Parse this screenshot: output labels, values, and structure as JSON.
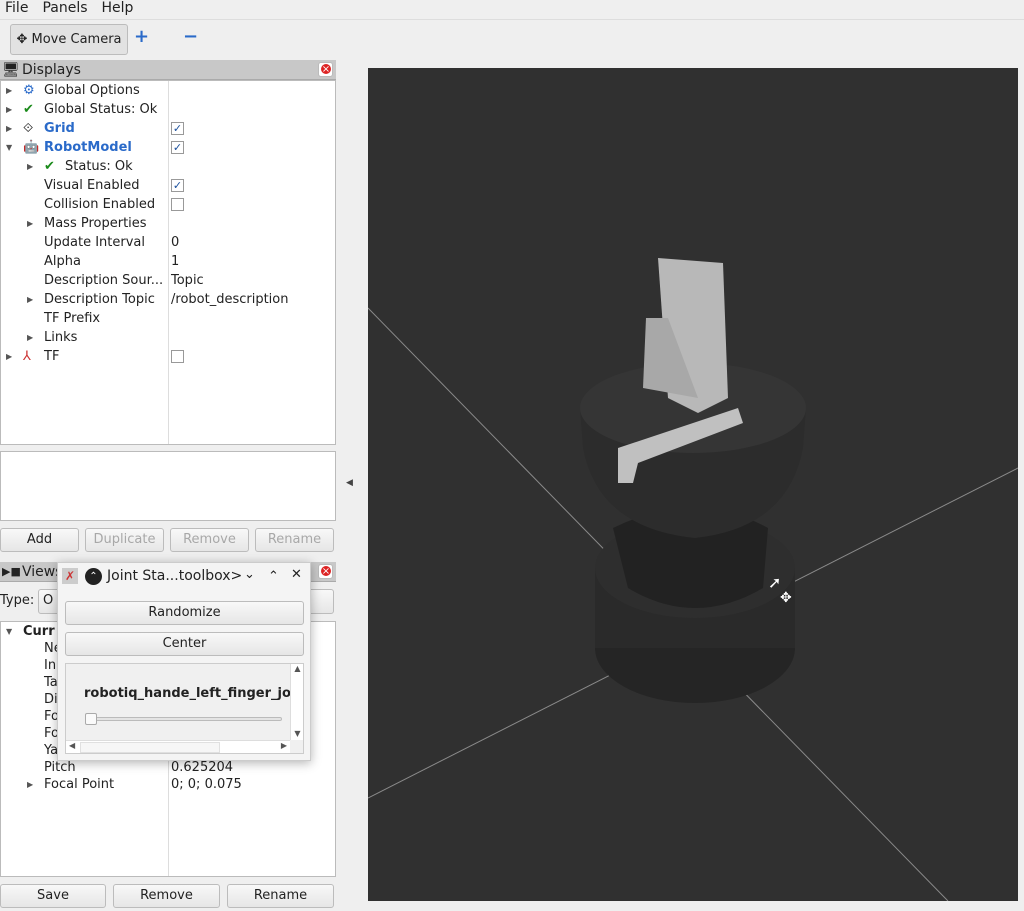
{
  "menu": [
    "File",
    "Panels",
    "Help"
  ],
  "toolbar": {
    "move_camera": "Move Camera",
    "add": "+",
    "remove": "−"
  },
  "displays": {
    "title": "Displays",
    "rows": [
      {
        "label": "Global Options",
        "value": ""
      },
      {
        "label": "Global Status: Ok",
        "value": ""
      },
      {
        "label": "Grid",
        "value": ""
      },
      {
        "label": "RobotModel",
        "value": ""
      },
      {
        "label": "Status: Ok",
        "value": ""
      },
      {
        "label": "Visual Enabled",
        "value": ""
      },
      {
        "label": "Collision Enabled",
        "value": ""
      },
      {
        "label": "Mass Properties",
        "value": ""
      },
      {
        "label": "Update Interval",
        "value": "0"
      },
      {
        "label": "Alpha",
        "value": "1"
      },
      {
        "label": "Description Sour...",
        "value": "Topic"
      },
      {
        "label": "Description Topic",
        "value": "/robot_description"
      },
      {
        "label": "TF Prefix",
        "value": ""
      },
      {
        "label": "Links",
        "value": ""
      },
      {
        "label": "TF",
        "value": ""
      }
    ],
    "buttons": {
      "add": "Add",
      "duplicate": "Duplicate",
      "remove": "Remove",
      "rename": "Rename"
    }
  },
  "views": {
    "title": "Views",
    "type_label": "Type:",
    "type_value": "O",
    "rows": [
      {
        "label": "Curr",
        "value": ""
      },
      {
        "label": "Ne",
        "value": ""
      },
      {
        "label": "In",
        "value": ""
      },
      {
        "label": "Ta",
        "value": ""
      },
      {
        "label": "Di",
        "value": ""
      },
      {
        "label": "Fo",
        "value": ""
      },
      {
        "label": "Fo",
        "value": ""
      },
      {
        "label": "Ya",
        "value": ""
      },
      {
        "label": "Pitch",
        "value": "0.625204"
      },
      {
        "label": "Focal Point",
        "value": "0; 0; 0.075"
      }
    ],
    "buttons": {
      "save": "Save",
      "remove": "Remove",
      "rename": "Rename"
    }
  },
  "joint_window": {
    "title": "Joint Sta...toolbox>",
    "randomize": "Randomize",
    "center": "Center",
    "joint_name": "robotiq_hande_left_finger_jo",
    "slider_value": 0
  },
  "viewport": {
    "background": "#303030"
  }
}
